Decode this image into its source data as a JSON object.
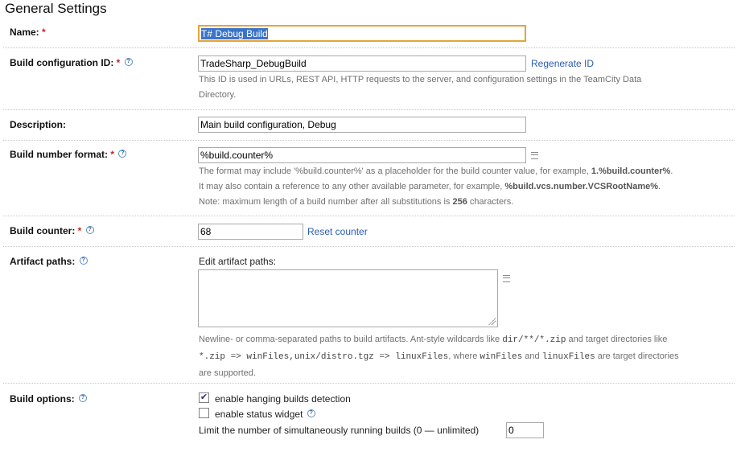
{
  "section_title": "General Settings",
  "required_mark": "*",
  "help_glyph": "?",
  "name": {
    "label": "Name:",
    "value": "T# Debug Build"
  },
  "build_id": {
    "label": "Build configuration ID:",
    "value": "TradeSharp_DebugBuild",
    "action": "Regenerate ID",
    "note_1": "This ID is used in URLs, REST API, HTTP requests to the server, and configuration settings in the TeamCity Data",
    "note_2": "Directory."
  },
  "description": {
    "label": "Description:",
    "value": "Main build configuration, Debug"
  },
  "build_number_format": {
    "label": "Build number format:",
    "value": "%build.counter%",
    "note_1a": "The format may include '%build.counter%' as a placeholder for the build counter value, for example, ",
    "note_1b": "1.%build.counter%",
    "note_1c": ".",
    "note_2a": "It may also contain a reference to any other available parameter, for example, ",
    "note_2b": "%build.vcs.number.VCSRootName%",
    "note_2c": ".",
    "note_3a": "Note: maximum length of a build number after all substitutions is ",
    "note_3b": "256",
    "note_3c": " characters."
  },
  "build_counter": {
    "label": "Build counter:",
    "value": "68",
    "action": "Reset counter"
  },
  "artifact_paths": {
    "label": "Artifact paths:",
    "edit_label": "Edit artifact paths:",
    "value": "",
    "note_1a": "Newline- or comma-separated paths to build artifacts. Ant-style wildcards like ",
    "note_1b": "dir/**/*.zip",
    "note_1c": " and target directories like",
    "note_2a": "*.zip => winFiles,unix/distro.tgz => linuxFiles",
    "note_2b": ", where ",
    "note_2c": "winFiles",
    "note_2d": " and ",
    "note_2e": "linuxFiles",
    "note_2f": " are target directories",
    "note_3": "are supported."
  },
  "build_options": {
    "label": "Build options:",
    "hanging": {
      "label": "enable hanging builds detection",
      "checked": true,
      "mark": "✔"
    },
    "status_widget": {
      "label": "enable status widget",
      "checked": false
    },
    "limit_label": "Limit the number of simultaneously running builds (0 — unlimited)",
    "limit_value": "0"
  }
}
